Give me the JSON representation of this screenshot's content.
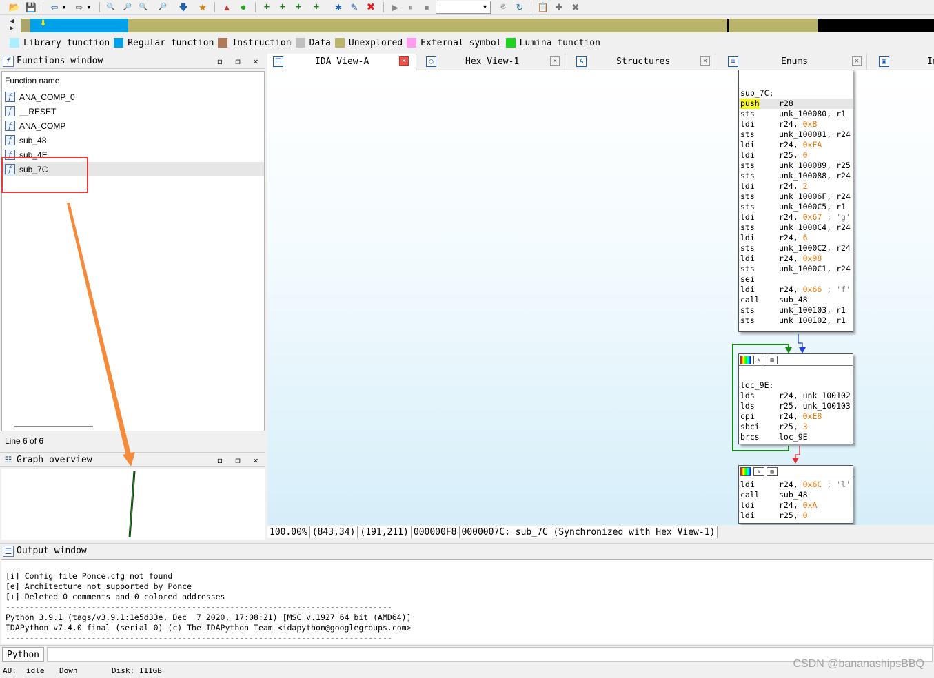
{
  "toolbar": {
    "icons": [
      "open-icon",
      "save-icon",
      "back-icon",
      "back-dropdown-icon",
      "forward-icon",
      "forward-dropdown-icon",
      "search-binary-icon",
      "search-text-icon",
      "search-immediate-icon",
      "search-next-icon",
      "jump-icon",
      "mark-icon",
      "graph-icon",
      "run-icon",
      "code-icon",
      "data-icon",
      "ascii-icon",
      "struct-icon",
      "enum-icon",
      "edit-icon",
      "undefine-icon",
      "play-icon",
      "pause-icon",
      "stop-icon",
      "settings-icon",
      "refresh-icon",
      "notes-icon",
      "plugin-icon",
      "clear-icon"
    ],
    "combo_value": ""
  },
  "legend": [
    {
      "label": "Library function",
      "color": "#aaeeff"
    },
    {
      "label": "Regular function",
      "color": "#00a1e9"
    },
    {
      "label": "Instruction",
      "color": "#b07a58"
    },
    {
      "label": "Data",
      "color": "#c0c0c0"
    },
    {
      "label": "Unexplored",
      "color": "#b9b46a"
    },
    {
      "label": "External symbol",
      "color": "#ff9cf0"
    },
    {
      "label": "Lumina function",
      "color": "#21d321"
    }
  ],
  "functions_window": {
    "title": "Functions window",
    "header": "Function name",
    "items": [
      "ANA_COMP_0",
      "__RESET",
      "ANA_COMP",
      "sub_48",
      "sub_4E",
      "sub_7C"
    ],
    "status": "Line 6 of 6"
  },
  "graph_overview": {
    "title": "Graph overview"
  },
  "tabs": [
    {
      "label": "IDA View-A"
    },
    {
      "label": "Hex View-1"
    },
    {
      "label": "Structures"
    },
    {
      "label": "Enums"
    },
    {
      "label": "Imports"
    }
  ],
  "graph": {
    "block1": {
      "label": "sub_7C:",
      "lines": [
        {
          "mn": "push",
          "op": "r28"
        },
        {
          "mn": "sts",
          "op": "unk_100080, r1"
        },
        {
          "mn": "ldi",
          "op": "r24, ",
          "num": "0xB"
        },
        {
          "mn": "sts",
          "op": "unk_100081, r24"
        },
        {
          "mn": "ldi",
          "op": "r24, ",
          "num": "0xFA"
        },
        {
          "mn": "ldi",
          "op": "r25, ",
          "num": "0"
        },
        {
          "mn": "sts",
          "op": "unk_100089, r25"
        },
        {
          "mn": "sts",
          "op": "unk_100088, r24"
        },
        {
          "mn": "ldi",
          "op": "r24, ",
          "num": "2"
        },
        {
          "mn": "sts",
          "op": "unk_10006F, r24"
        },
        {
          "mn": "sts",
          "op": "unk_1000C5, r1"
        },
        {
          "mn": "ldi",
          "op": "r24, ",
          "num": "0x67",
          "cmt": " ; 'g'"
        },
        {
          "mn": "sts",
          "op": "unk_1000C4, r24"
        },
        {
          "mn": "ldi",
          "op": "r24, ",
          "num": "6"
        },
        {
          "mn": "sts",
          "op": "unk_1000C2, r24"
        },
        {
          "mn": "ldi",
          "op": "r24, ",
          "num": "0x98"
        },
        {
          "mn": "sts",
          "op": "unk_1000C1, r24"
        },
        {
          "mn": "sei",
          "op": ""
        },
        {
          "mn": "ldi",
          "op": "r24, ",
          "num": "0x66",
          "cmt": " ; 'f'"
        },
        {
          "mn": "call",
          "op": "sub_48"
        },
        {
          "mn": "sts",
          "op": "unk_100103, r1"
        },
        {
          "mn": "sts",
          "op": "unk_100102, r1"
        }
      ]
    },
    "block2": {
      "label": "loc_9E:",
      "lines": [
        {
          "mn": "lds",
          "op": "r24, unk_100102"
        },
        {
          "mn": "lds",
          "op": "r25, unk_100103"
        },
        {
          "mn": "cpi",
          "op": "r24, ",
          "num": "0xE8"
        },
        {
          "mn": "sbci",
          "op": "r25, ",
          "num": "3"
        },
        {
          "mn": "brcs",
          "op": "loc_9E"
        }
      ]
    },
    "block3": {
      "lines": [
        {
          "mn": "ldi",
          "op": "r24, ",
          "num": "0x6C",
          "cmt": " ; 'l'"
        },
        {
          "mn": "call",
          "op": "sub_48"
        },
        {
          "mn": "ldi",
          "op": "r24, ",
          "num": "0xA"
        },
        {
          "mn": "ldi",
          "op": "r25, ",
          "num": "0"
        }
      ]
    }
  },
  "graph_status": [
    "100.00%",
    "(843,34)",
    "(191,211)",
    "000000F8",
    "0000007C: sub_7C (Synchronized with Hex View-1)"
  ],
  "output": {
    "title": "Output window",
    "lines": [
      "[i] Config file Ponce.cfg not found",
      "[e] Architecture not supported by Ponce",
      "[+] Deleted 0 comments and 0 colored addresses",
      "---------------------------------------------------------------------------------",
      "Python 3.9.1 (tags/v3.9.1:1e5d33e, Dec  7 2020, 17:08:21) [MSC v.1927 64 bit (AMD64)]",
      "IDAPython v7.4.0 final (serial 0) (c) The IDAPython Team <idapython@googlegroups.com>",
      "---------------------------------------------------------------------------------"
    ]
  },
  "python_button": "Python",
  "statusbar": {
    "au_label": "AU:",
    "au_value": "idle",
    "direction": "Down",
    "disk": "Disk: 111GB"
  },
  "watermark": "CSDN @bananashipsBBQ"
}
